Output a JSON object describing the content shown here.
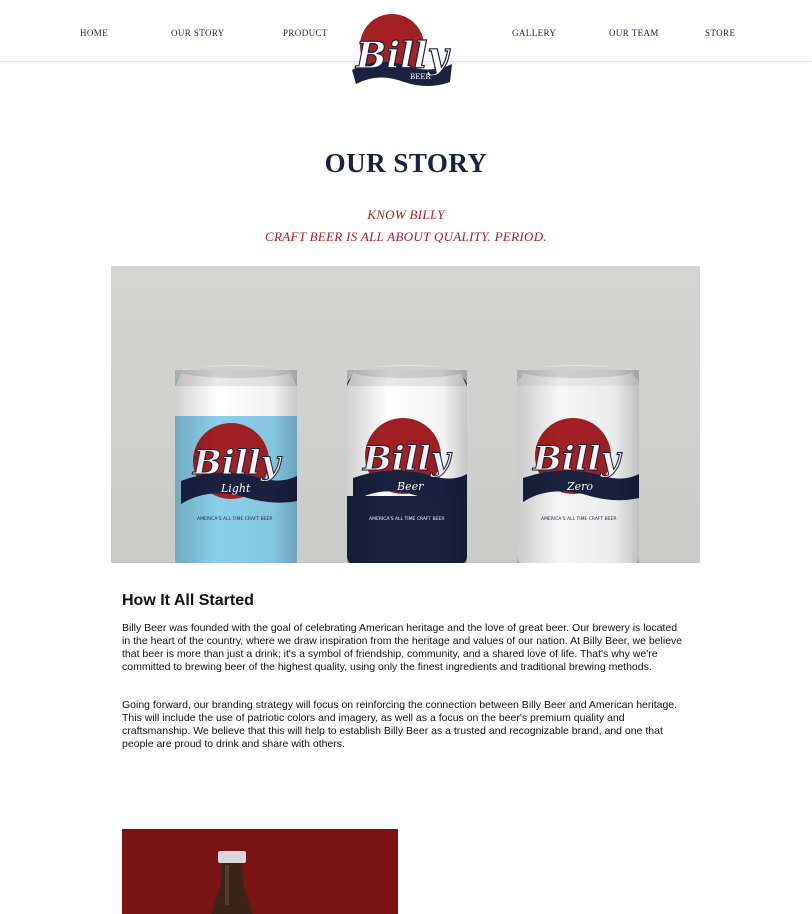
{
  "nav": {
    "home": "HOME",
    "our_story": "OUR STORY",
    "product": "PRODUCT",
    "gallery": "GALLERY",
    "our_team": "OUR TEAM",
    "store": "STORE"
  },
  "logo": {
    "icon": "billy-beer-logo",
    "lettering": [
      "Billy",
      "BEER"
    ]
  },
  "hero": {
    "title": "OUR STORY",
    "tagline_line1": "KNOW BILLY",
    "tagline_line2": "CRAFT BEER IS ALL ABOUT QUALITY. PERIOD."
  },
  "product_photo": {
    "cans": [
      {
        "name": "Billy",
        "variant": "Light",
        "color": "#8ad0ea"
      },
      {
        "name": "Billy",
        "variant": "Beer",
        "color": "#1c2340"
      },
      {
        "name": "Billy",
        "variant": "Zero",
        "color": "#ffffff"
      }
    ],
    "can_tagline": "AMERICA'S ALL TIME CRAFT BEER"
  },
  "story": {
    "heading": "How It All Started",
    "paragraph1": "Billy Beer was founded with the goal of celebrating American heritage and the love of great beer. Our brewery is located in the heart of the country, where we draw inspiration from the heritage and values of our nation. At Billy Beer, we believe that beer is more than just a drink; it's a symbol of friendship, community, and a shared love of life. That's why we're committed to brewing beer of the highest quality, using only the finest ingredients and traditional brewing methods.",
    "paragraph2": "Going forward, our branding strategy will focus on reinforcing the connection between Billy Beer and American heritage. This will include the use of patriotic colors and imagery, as well as a focus on the beer's premium quality and craftsmanship. We believe that this will help to establish Billy Beer as a trusted and recognizable brand, and one that people are proud to drink and share with others."
  },
  "colors": {
    "navy": "#1b2240",
    "red": "#a32024",
    "maroon": "#7a1414"
  }
}
